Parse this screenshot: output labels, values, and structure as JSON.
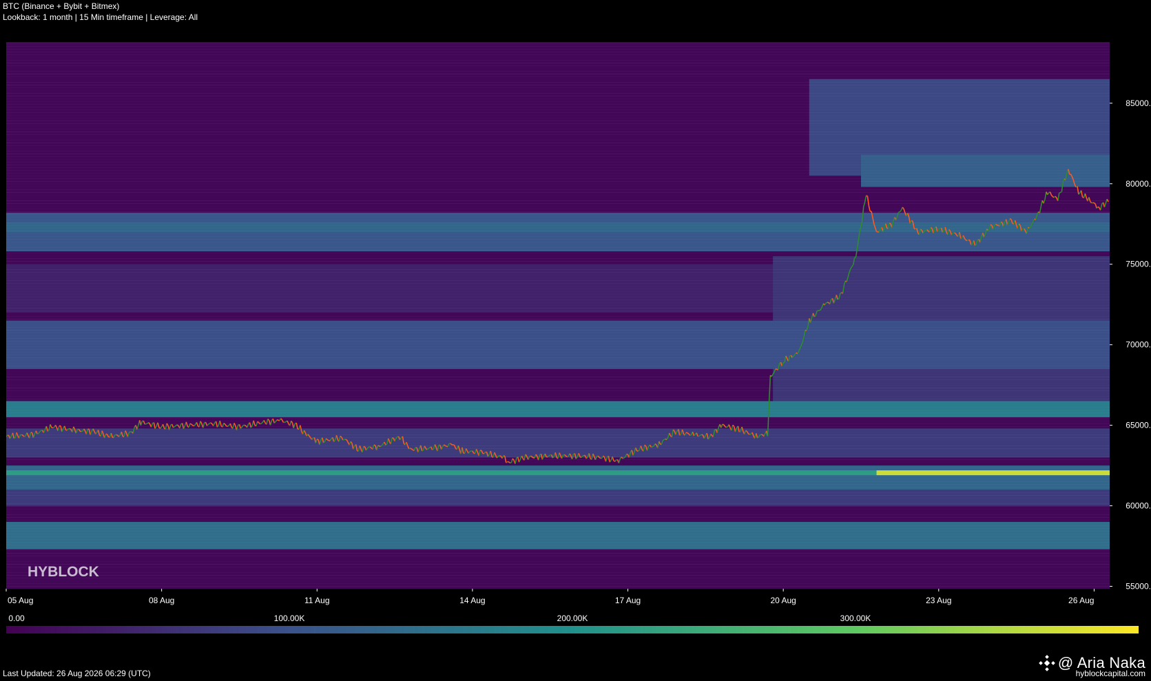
{
  "header": {
    "title": "BTC (Binance + Bybit + Bitmex)",
    "subtitle": "Lookback: 1 month | 15 Min timeframe | Leverage: All"
  },
  "watermark": "HYBLOCK",
  "footer": {
    "last_updated": "Last Updated: 26 Aug 2026 06:29 (UTC)",
    "handle": "@ Aria Naka",
    "site": "hyblockcapital.com",
    "logo_icon": "binance-diamond-icon"
  },
  "colors": {
    "background": "#000000",
    "heatmap_low": "#440154",
    "heatmap_mid": "#21918c",
    "heatmap_high": "#fde725",
    "candle_up": "#2e8b2e",
    "candle_down": "#ff5a1f"
  },
  "colorbar": {
    "ticks": [
      "0.00",
      "100.00K",
      "200.00K",
      "300.00K"
    ],
    "tick_values": [
      0,
      100000,
      200000,
      300000
    ],
    "max": 400000
  },
  "chart_data": {
    "type": "heatmap",
    "title": "BTC (Binance + Bybit + Bitmex)",
    "x_tick_labels": [
      "05 Aug",
      "08 Aug",
      "11 Aug",
      "14 Aug",
      "17 Aug",
      "20 Aug",
      "23 Aug",
      "26 Aug"
    ],
    "x_tick_days": [
      0,
      3,
      6,
      9,
      12,
      15,
      18,
      21
    ],
    "xlim_days": [
      0,
      21.3
    ],
    "y_tick_labels": [
      "55000.0",
      "60000.0",
      "65000.0",
      "70000.0",
      "75000.0",
      "80000.0",
      "85000.0"
    ],
    "y_tick_values": [
      55000,
      60000,
      65000,
      70000,
      75000,
      80000,
      85000
    ],
    "ylim": [
      54850,
      88800
    ],
    "grid": false,
    "price_path": [
      [
        0.0,
        64300
      ],
      [
        0.5,
        64400
      ],
      [
        0.9,
        64900
      ],
      [
        1.3,
        64700
      ],
      [
        1.7,
        64600
      ],
      [
        2.0,
        64300
      ],
      [
        2.4,
        64500
      ],
      [
        2.6,
        65200
      ],
      [
        3.0,
        64900
      ],
      [
        3.5,
        65000
      ],
      [
        4.0,
        65100
      ],
      [
        4.5,
        64900
      ],
      [
        5.0,
        65200
      ],
      [
        5.3,
        65300
      ],
      [
        5.6,
        65000
      ],
      [
        5.8,
        64400
      ],
      [
        6.0,
        64000
      ],
      [
        6.5,
        64200
      ],
      [
        6.8,
        63500
      ],
      [
        7.2,
        63700
      ],
      [
        7.6,
        64300
      ],
      [
        7.8,
        63500
      ],
      [
        8.3,
        63600
      ],
      [
        8.6,
        63800
      ],
      [
        8.8,
        63400
      ],
      [
        9.2,
        63300
      ],
      [
        9.6,
        63000
      ],
      [
        9.7,
        62700
      ],
      [
        10.0,
        63000
      ],
      [
        10.5,
        63100
      ],
      [
        11.0,
        63100
      ],
      [
        11.5,
        63000
      ],
      [
        11.8,
        62800
      ],
      [
        12.2,
        63500
      ],
      [
        12.6,
        63800
      ],
      [
        12.9,
        64600
      ],
      [
        13.3,
        64400
      ],
      [
        13.6,
        64300
      ],
      [
        13.8,
        65000
      ],
      [
        14.1,
        64800
      ],
      [
        14.5,
        64300
      ],
      [
        14.7,
        64500
      ],
      [
        14.75,
        68000
      ],
      [
        15.0,
        69000
      ],
      [
        15.3,
        69500
      ],
      [
        15.5,
        71500
      ],
      [
        15.8,
        72500
      ],
      [
        16.1,
        73000
      ],
      [
        16.4,
        75500
      ],
      [
        16.6,
        79300
      ],
      [
        16.8,
        77000
      ],
      [
        17.1,
        77500
      ],
      [
        17.3,
        78500
      ],
      [
        17.6,
        77000
      ],
      [
        18.0,
        77200
      ],
      [
        18.4,
        76800
      ],
      [
        18.7,
        76200
      ],
      [
        19.0,
        77300
      ],
      [
        19.4,
        77700
      ],
      [
        19.7,
        77000
      ],
      [
        19.9,
        78000
      ],
      [
        20.1,
        79500
      ],
      [
        20.3,
        79000
      ],
      [
        20.5,
        80900
      ],
      [
        20.7,
        79500
      ],
      [
        20.9,
        79000
      ],
      [
        21.1,
        78500
      ],
      [
        21.3,
        79000
      ]
    ],
    "liquidity_bands": [
      {
        "low": 75800,
        "high": 78200,
        "intensity": 0.27,
        "start_day": 0
      },
      {
        "low": 77000,
        "high": 77600,
        "intensity": 0.33,
        "start_day": 0
      },
      {
        "low": 68500,
        "high": 71500,
        "intensity": 0.24,
        "start_day": 0
      },
      {
        "low": 65500,
        "high": 66500,
        "intensity": 0.42,
        "start_day": 0
      },
      {
        "low": 61900,
        "high": 62200,
        "intensity": 0.55,
        "start_day": 0
      },
      {
        "low": 61900,
        "high": 62200,
        "intensity": 0.92,
        "start_day": 16.8
      },
      {
        "low": 61000,
        "high": 62500,
        "intensity": 0.33,
        "start_day": 0
      },
      {
        "low": 57300,
        "high": 59000,
        "intensity": 0.36,
        "start_day": 0
      },
      {
        "low": 60000,
        "high": 61000,
        "intensity": 0.18,
        "start_day": 0
      },
      {
        "low": 63000,
        "high": 64800,
        "intensity": 0.18,
        "start_day": 0
      },
      {
        "low": 72000,
        "high": 75000,
        "intensity": 0.1,
        "start_day": 0
      },
      {
        "low": 80500,
        "high": 86500,
        "intensity": 0.22,
        "start_day": 15.5
      },
      {
        "low": 79800,
        "high": 81800,
        "intensity": 0.3,
        "start_day": 16.5
      },
      {
        "low": 65500,
        "high": 75500,
        "intensity": 0.16,
        "start_day": 14.8
      }
    ]
  }
}
